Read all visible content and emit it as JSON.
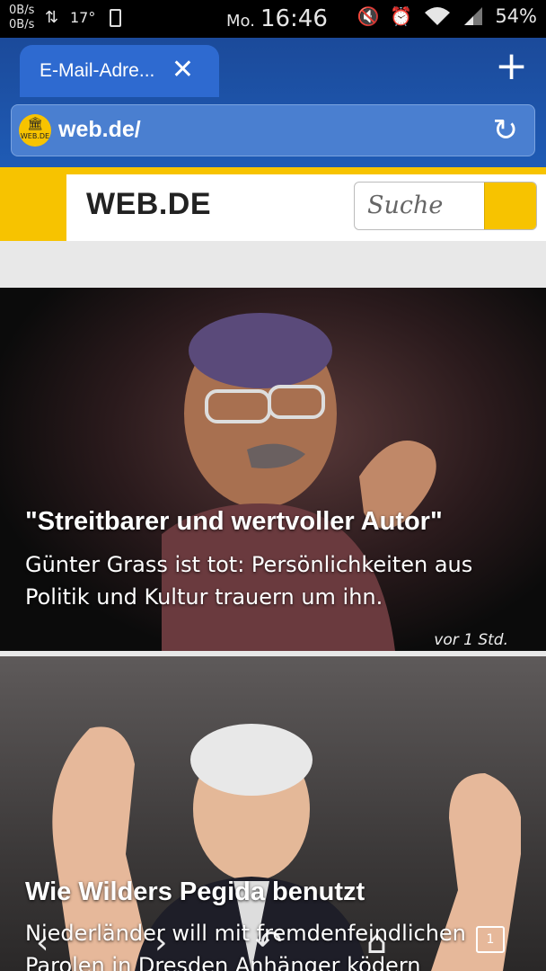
{
  "status_bar": {
    "net_up": "0B/s",
    "net_down": "0B/s",
    "temperature": "17°",
    "day": "Mo.",
    "time": "16:46",
    "battery": "54%"
  },
  "browser": {
    "tab_title": "E-Mail-Adre...",
    "url": "web.de/",
    "site_icon_text": "WEB.DE",
    "tab_count": "1"
  },
  "site": {
    "brand": "WEB.DE",
    "search_placeholder": "Suche",
    "accent_color": "#f7c300"
  },
  "articles": [
    {
      "headline": "\"Streitbarer und wertvoller Autor\"",
      "teaser": "Günter Grass ist tot: Persönlichkeiten aus Politik und Kultur trauern um ihn.",
      "time": "vor 1 Std."
    },
    {
      "headline": "Wie Wilders Pegida benutzt",
      "teaser": "Niederländer will mit fremdenfeindlichen Parolen in Dresden Anhänger ködern"
    }
  ]
}
